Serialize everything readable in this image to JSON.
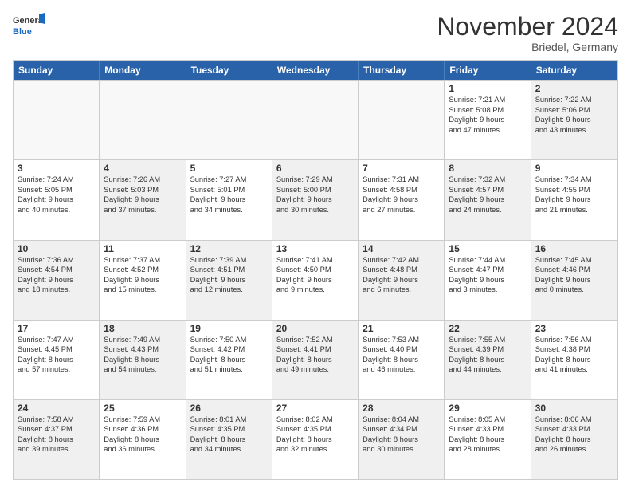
{
  "logo": {
    "line1": "General",
    "line2": "Blue"
  },
  "title": "November 2024",
  "subtitle": "Briedel, Germany",
  "days": [
    "Sunday",
    "Monday",
    "Tuesday",
    "Wednesday",
    "Thursday",
    "Friday",
    "Saturday"
  ],
  "rows": [
    [
      {
        "empty": true
      },
      {
        "empty": true
      },
      {
        "empty": true
      },
      {
        "empty": true
      },
      {
        "empty": true
      },
      {
        "day": "1",
        "lines": [
          "Sunrise: 7:21 AM",
          "Sunset: 5:08 PM",
          "Daylight: 9 hours",
          "and 47 minutes."
        ]
      },
      {
        "day": "2",
        "shaded": true,
        "lines": [
          "Sunrise: 7:22 AM",
          "Sunset: 5:06 PM",
          "Daylight: 9 hours",
          "and 43 minutes."
        ]
      }
    ],
    [
      {
        "day": "3",
        "lines": [
          "Sunrise: 7:24 AM",
          "Sunset: 5:05 PM",
          "Daylight: 9 hours",
          "and 40 minutes."
        ]
      },
      {
        "day": "4",
        "shaded": true,
        "lines": [
          "Sunrise: 7:26 AM",
          "Sunset: 5:03 PM",
          "Daylight: 9 hours",
          "and 37 minutes."
        ]
      },
      {
        "day": "5",
        "lines": [
          "Sunrise: 7:27 AM",
          "Sunset: 5:01 PM",
          "Daylight: 9 hours",
          "and 34 minutes."
        ]
      },
      {
        "day": "6",
        "shaded": true,
        "lines": [
          "Sunrise: 7:29 AM",
          "Sunset: 5:00 PM",
          "Daylight: 9 hours",
          "and 30 minutes."
        ]
      },
      {
        "day": "7",
        "lines": [
          "Sunrise: 7:31 AM",
          "Sunset: 4:58 PM",
          "Daylight: 9 hours",
          "and 27 minutes."
        ]
      },
      {
        "day": "8",
        "shaded": true,
        "lines": [
          "Sunrise: 7:32 AM",
          "Sunset: 4:57 PM",
          "Daylight: 9 hours",
          "and 24 minutes."
        ]
      },
      {
        "day": "9",
        "lines": [
          "Sunrise: 7:34 AM",
          "Sunset: 4:55 PM",
          "Daylight: 9 hours",
          "and 21 minutes."
        ]
      }
    ],
    [
      {
        "day": "10",
        "shaded": true,
        "lines": [
          "Sunrise: 7:36 AM",
          "Sunset: 4:54 PM",
          "Daylight: 9 hours",
          "and 18 minutes."
        ]
      },
      {
        "day": "11",
        "lines": [
          "Sunrise: 7:37 AM",
          "Sunset: 4:52 PM",
          "Daylight: 9 hours",
          "and 15 minutes."
        ]
      },
      {
        "day": "12",
        "shaded": true,
        "lines": [
          "Sunrise: 7:39 AM",
          "Sunset: 4:51 PM",
          "Daylight: 9 hours",
          "and 12 minutes."
        ]
      },
      {
        "day": "13",
        "lines": [
          "Sunrise: 7:41 AM",
          "Sunset: 4:50 PM",
          "Daylight: 9 hours",
          "and 9 minutes."
        ]
      },
      {
        "day": "14",
        "shaded": true,
        "lines": [
          "Sunrise: 7:42 AM",
          "Sunset: 4:48 PM",
          "Daylight: 9 hours",
          "and 6 minutes."
        ]
      },
      {
        "day": "15",
        "lines": [
          "Sunrise: 7:44 AM",
          "Sunset: 4:47 PM",
          "Daylight: 9 hours",
          "and 3 minutes."
        ]
      },
      {
        "day": "16",
        "shaded": true,
        "lines": [
          "Sunrise: 7:45 AM",
          "Sunset: 4:46 PM",
          "Daylight: 9 hours",
          "and 0 minutes."
        ]
      }
    ],
    [
      {
        "day": "17",
        "lines": [
          "Sunrise: 7:47 AM",
          "Sunset: 4:45 PM",
          "Daylight: 8 hours",
          "and 57 minutes."
        ]
      },
      {
        "day": "18",
        "shaded": true,
        "lines": [
          "Sunrise: 7:49 AM",
          "Sunset: 4:43 PM",
          "Daylight: 8 hours",
          "and 54 minutes."
        ]
      },
      {
        "day": "19",
        "lines": [
          "Sunrise: 7:50 AM",
          "Sunset: 4:42 PM",
          "Daylight: 8 hours",
          "and 51 minutes."
        ]
      },
      {
        "day": "20",
        "shaded": true,
        "lines": [
          "Sunrise: 7:52 AM",
          "Sunset: 4:41 PM",
          "Daylight: 8 hours",
          "and 49 minutes."
        ]
      },
      {
        "day": "21",
        "lines": [
          "Sunrise: 7:53 AM",
          "Sunset: 4:40 PM",
          "Daylight: 8 hours",
          "and 46 minutes."
        ]
      },
      {
        "day": "22",
        "shaded": true,
        "lines": [
          "Sunrise: 7:55 AM",
          "Sunset: 4:39 PM",
          "Daylight: 8 hours",
          "and 44 minutes."
        ]
      },
      {
        "day": "23",
        "lines": [
          "Sunrise: 7:56 AM",
          "Sunset: 4:38 PM",
          "Daylight: 8 hours",
          "and 41 minutes."
        ]
      }
    ],
    [
      {
        "day": "24",
        "shaded": true,
        "lines": [
          "Sunrise: 7:58 AM",
          "Sunset: 4:37 PM",
          "Daylight: 8 hours",
          "and 39 minutes."
        ]
      },
      {
        "day": "25",
        "lines": [
          "Sunrise: 7:59 AM",
          "Sunset: 4:36 PM",
          "Daylight: 8 hours",
          "and 36 minutes."
        ]
      },
      {
        "day": "26",
        "shaded": true,
        "lines": [
          "Sunrise: 8:01 AM",
          "Sunset: 4:35 PM",
          "Daylight: 8 hours",
          "and 34 minutes."
        ]
      },
      {
        "day": "27",
        "lines": [
          "Sunrise: 8:02 AM",
          "Sunset: 4:35 PM",
          "Daylight: 8 hours",
          "and 32 minutes."
        ]
      },
      {
        "day": "28",
        "shaded": true,
        "lines": [
          "Sunrise: 8:04 AM",
          "Sunset: 4:34 PM",
          "Daylight: 8 hours",
          "and 30 minutes."
        ]
      },
      {
        "day": "29",
        "lines": [
          "Sunrise: 8:05 AM",
          "Sunset: 4:33 PM",
          "Daylight: 8 hours",
          "and 28 minutes."
        ]
      },
      {
        "day": "30",
        "shaded": true,
        "lines": [
          "Sunrise: 8:06 AM",
          "Sunset: 4:33 PM",
          "Daylight: 8 hours",
          "and 26 minutes."
        ]
      }
    ]
  ]
}
